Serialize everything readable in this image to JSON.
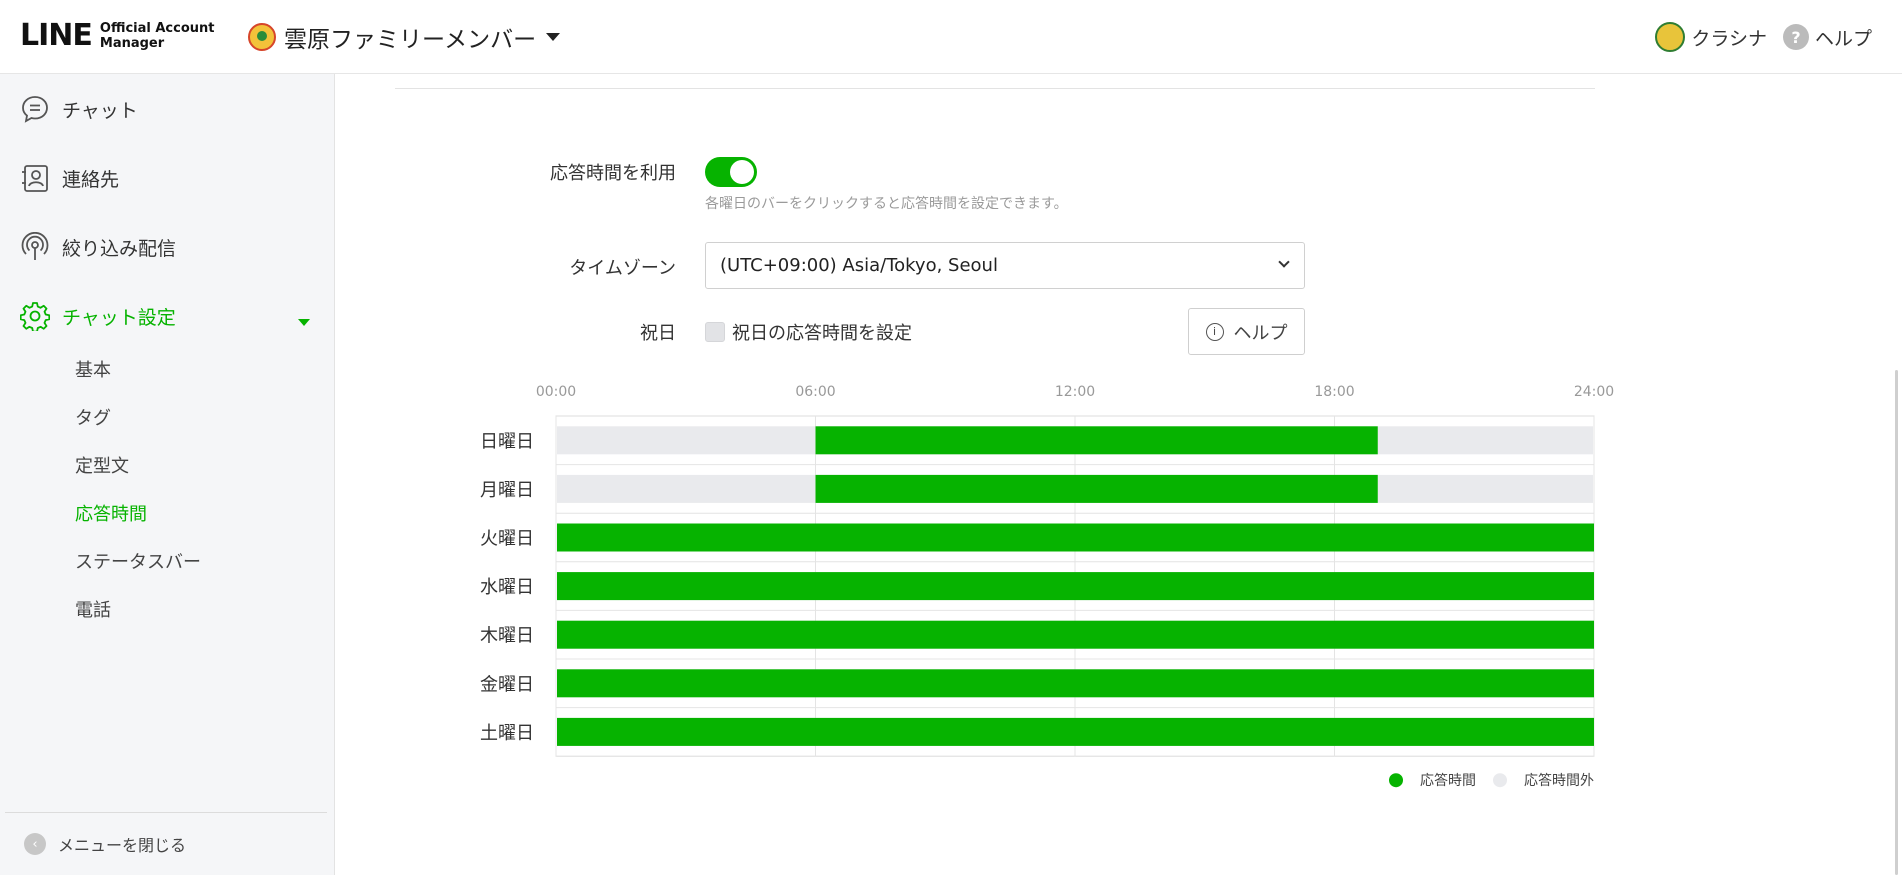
{
  "header": {
    "logo_main": "LINE",
    "logo_sub_1": "Official Account",
    "logo_sub_2": "Manager",
    "account_name": "雲原ファミリーメンバー",
    "user_name": "クラシナ",
    "help_label": "ヘルプ",
    "help_glyph": "?"
  },
  "sidebar": {
    "items": [
      {
        "label": "チャット",
        "icon": "chat-bubble-icon"
      },
      {
        "label": "連絡先",
        "icon": "contact-card-icon"
      },
      {
        "label": "絞り込み配信",
        "icon": "broadcast-icon"
      },
      {
        "label": "チャット設定",
        "icon": "gear-icon",
        "active": true
      }
    ],
    "sub_items": [
      {
        "label": "基本"
      },
      {
        "label": "タグ"
      },
      {
        "label": "定型文"
      },
      {
        "label": "応答時間",
        "active": true
      },
      {
        "label": "ステータスバー"
      },
      {
        "label": "電話"
      }
    ],
    "close_menu_label": "メニューを閉じる",
    "close_menu_glyph": "‹"
  },
  "form": {
    "response_time_label": "応答時間を利用",
    "response_time_enabled": true,
    "hint": "各曜日のバーをクリックすると応答時間を設定できます。",
    "timezone_label": "タイムゾーン",
    "timezone_value": "(UTC+09:00) Asia/Tokyo, Seoul",
    "holiday_label": "祝日",
    "holiday_checkbox_label": "祝日の応答時間を設定",
    "holiday_checked": false,
    "help_button_label": "ヘルプ",
    "help_button_glyph": "i"
  },
  "colors": {
    "accent": "#06b300",
    "inactive_bar": "#e9eaed"
  },
  "chart_data": {
    "type": "bar",
    "orientation": "horizontal-range",
    "x_ticks": [
      "00:00",
      "06:00",
      "12:00",
      "18:00",
      "24:00"
    ],
    "xlim": [
      0,
      24
    ],
    "categories": [
      "日曜日",
      "月曜日",
      "火曜日",
      "水曜日",
      "木曜日",
      "金曜日",
      "土曜日"
    ],
    "series": [
      {
        "name": "応答時間",
        "ranges": [
          [
            6,
            19
          ],
          [
            6,
            19
          ],
          [
            0,
            24
          ],
          [
            0,
            24
          ],
          [
            0,
            24
          ],
          [
            0,
            24
          ],
          [
            0,
            24
          ]
        ]
      }
    ],
    "legend": [
      {
        "label": "応答時間",
        "color": "#06b300"
      },
      {
        "label": "応答時間外",
        "color": "#e9eaed"
      }
    ],
    "legend_position": "bottom-right",
    "grid": true
  }
}
